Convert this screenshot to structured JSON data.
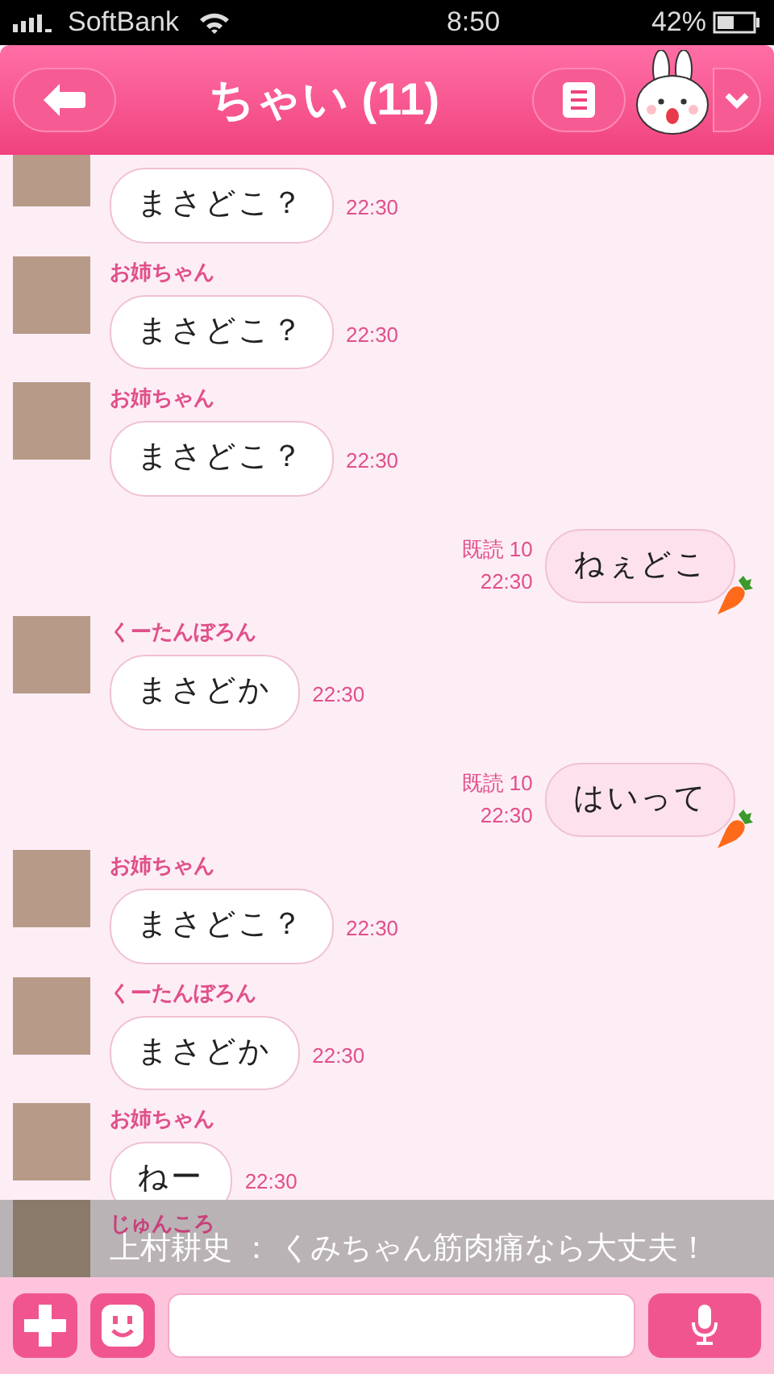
{
  "status_bar": {
    "carrier": "SoftBank",
    "time": "8:50",
    "battery": "42%"
  },
  "header": {
    "title": "ちゃい (11)"
  },
  "messages": [
    {
      "kind": "in",
      "text": "まさどこ？",
      "time": "22:30"
    },
    {
      "kind": "in",
      "sender": "お姉ちゃん",
      "text": "まさどこ？",
      "time": "22:30"
    },
    {
      "kind": "in",
      "sender": "お姉ちゃん",
      "text": "まさどこ？",
      "time": "22:30"
    },
    {
      "kind": "out",
      "read": "既読 10",
      "text": "ねぇどこ",
      "time": "22:30"
    },
    {
      "kind": "in",
      "sender": "くーたんぼろん",
      "text": "まさどか",
      "time": "22:30"
    },
    {
      "kind": "out",
      "read": "既読 10",
      "text": "はいって",
      "time": "22:30"
    },
    {
      "kind": "in",
      "sender": "お姉ちゃん",
      "text": "まさどこ？",
      "time": "22:30"
    },
    {
      "kind": "in",
      "sender": "くーたんぼろん",
      "text": "まさどか",
      "time": "22:30"
    },
    {
      "kind": "in",
      "sender": "お姉ちゃん",
      "text": "ねー",
      "time": "22:30"
    }
  ],
  "notification": {
    "sender": "じゅんころ",
    "text": "上村耕史 ： くみちゃん筋肉痛なら大丈夫！"
  }
}
